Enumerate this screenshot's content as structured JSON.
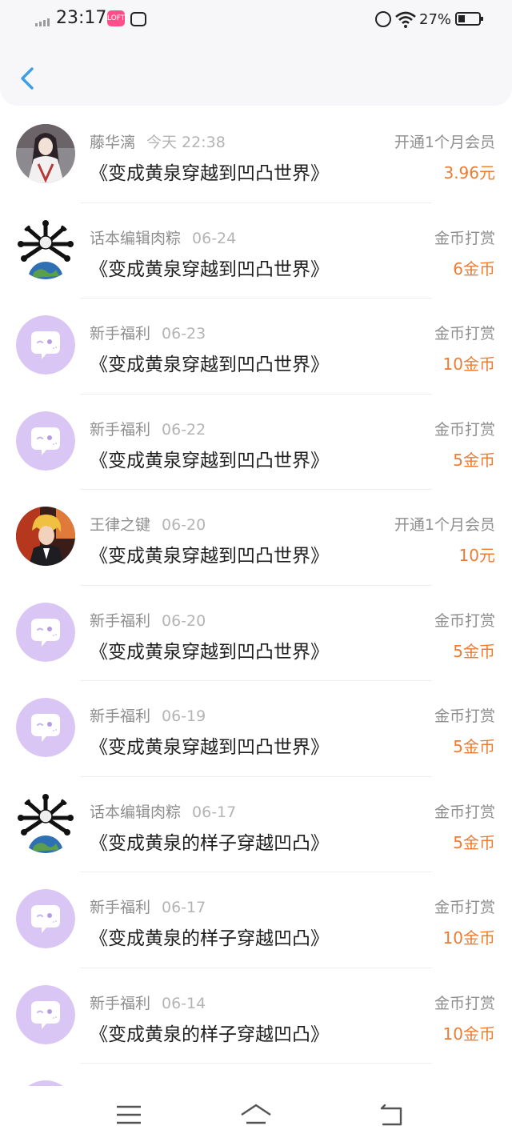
{
  "status_bar": {
    "time": "23:17",
    "battery": "27%",
    "app_badge": "LOFTER"
  },
  "colors": {
    "amount": "#ee7b30",
    "back": "#3b9ee8",
    "welfare_avatar": "#d9c6f5"
  },
  "records": [
    {
      "avatar": "portrait-white-robe",
      "user": "藤华漓",
      "date": "今天 22:38",
      "book": "《变成黄泉穿越到凹凸世界》",
      "type": "开通1个月会员",
      "amount": "3.96元"
    },
    {
      "avatar": "editor-earth-bones",
      "user": "话本编辑肉粽",
      "date": "06-24",
      "book": "《变成黄泉穿越到凹凸世界》",
      "type": "金币打赏",
      "amount": "6金币"
    },
    {
      "avatar": "welfare-chat-bubble",
      "user": "新手福利",
      "date": "06-23",
      "book": "《变成黄泉穿越到凹凸世界》",
      "type": "金币打赏",
      "amount": "10金币"
    },
    {
      "avatar": "welfare-chat-bubble",
      "user": "新手福利",
      "date": "06-22",
      "book": "《变成黄泉穿越到凹凸世界》",
      "type": "金币打赏",
      "amount": "5金币"
    },
    {
      "avatar": "portrait-blond",
      "user": "王律之键",
      "date": "06-20",
      "book": "《变成黄泉穿越到凹凸世界》",
      "type": "开通1个月会员",
      "amount": "10元"
    },
    {
      "avatar": "welfare-chat-bubble",
      "user": "新手福利",
      "date": "06-20",
      "book": "《变成黄泉穿越到凹凸世界》",
      "type": "金币打赏",
      "amount": "5金币"
    },
    {
      "avatar": "welfare-chat-bubble",
      "user": "新手福利",
      "date": "06-19",
      "book": "《变成黄泉穿越到凹凸世界》",
      "type": "金币打赏",
      "amount": "5金币"
    },
    {
      "avatar": "editor-earth-bones",
      "user": "话本编辑肉粽",
      "date": "06-17",
      "book": "《变成黄泉的样子穿越凹凸》",
      "type": "金币打赏",
      "amount": "5金币"
    },
    {
      "avatar": "welfare-chat-bubble",
      "user": "新手福利",
      "date": "06-17",
      "book": "《变成黄泉的样子穿越凹凸》",
      "type": "金币打赏",
      "amount": "10金币"
    },
    {
      "avatar": "welfare-chat-bubble",
      "user": "新手福利",
      "date": "06-14",
      "book": "《变成黄泉的样子穿越凹凸》",
      "type": "金币打赏",
      "amount": "10金币"
    }
  ],
  "nav_icons": [
    "menu-icon",
    "home-icon",
    "back-nav-icon"
  ]
}
